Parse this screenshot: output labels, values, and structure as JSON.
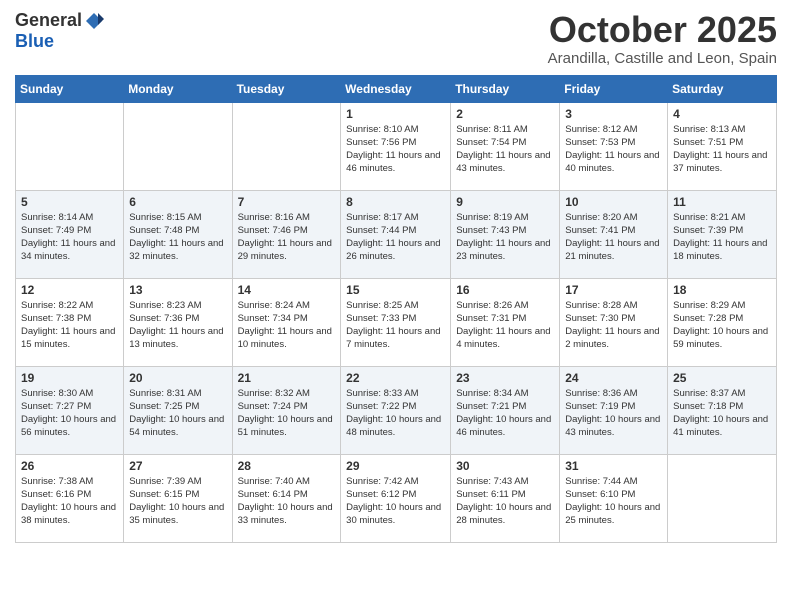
{
  "header": {
    "logo_general": "General",
    "logo_blue": "Blue",
    "month_title": "October 2025",
    "location": "Arandilla, Castille and Leon, Spain"
  },
  "days_of_week": [
    "Sunday",
    "Monday",
    "Tuesday",
    "Wednesday",
    "Thursday",
    "Friday",
    "Saturday"
  ],
  "weeks": [
    {
      "days": [
        {
          "num": "",
          "sunrise": "",
          "sunset": "",
          "daylight": ""
        },
        {
          "num": "",
          "sunrise": "",
          "sunset": "",
          "daylight": ""
        },
        {
          "num": "",
          "sunrise": "",
          "sunset": "",
          "daylight": ""
        },
        {
          "num": "1",
          "sunrise": "Sunrise: 8:10 AM",
          "sunset": "Sunset: 7:56 PM",
          "daylight": "Daylight: 11 hours and 46 minutes."
        },
        {
          "num": "2",
          "sunrise": "Sunrise: 8:11 AM",
          "sunset": "Sunset: 7:54 PM",
          "daylight": "Daylight: 11 hours and 43 minutes."
        },
        {
          "num": "3",
          "sunrise": "Sunrise: 8:12 AM",
          "sunset": "Sunset: 7:53 PM",
          "daylight": "Daylight: 11 hours and 40 minutes."
        },
        {
          "num": "4",
          "sunrise": "Sunrise: 8:13 AM",
          "sunset": "Sunset: 7:51 PM",
          "daylight": "Daylight: 11 hours and 37 minutes."
        }
      ]
    },
    {
      "days": [
        {
          "num": "5",
          "sunrise": "Sunrise: 8:14 AM",
          "sunset": "Sunset: 7:49 PM",
          "daylight": "Daylight: 11 hours and 34 minutes."
        },
        {
          "num": "6",
          "sunrise": "Sunrise: 8:15 AM",
          "sunset": "Sunset: 7:48 PM",
          "daylight": "Daylight: 11 hours and 32 minutes."
        },
        {
          "num": "7",
          "sunrise": "Sunrise: 8:16 AM",
          "sunset": "Sunset: 7:46 PM",
          "daylight": "Daylight: 11 hours and 29 minutes."
        },
        {
          "num": "8",
          "sunrise": "Sunrise: 8:17 AM",
          "sunset": "Sunset: 7:44 PM",
          "daylight": "Daylight: 11 hours and 26 minutes."
        },
        {
          "num": "9",
          "sunrise": "Sunrise: 8:19 AM",
          "sunset": "Sunset: 7:43 PM",
          "daylight": "Daylight: 11 hours and 23 minutes."
        },
        {
          "num": "10",
          "sunrise": "Sunrise: 8:20 AM",
          "sunset": "Sunset: 7:41 PM",
          "daylight": "Daylight: 11 hours and 21 minutes."
        },
        {
          "num": "11",
          "sunrise": "Sunrise: 8:21 AM",
          "sunset": "Sunset: 7:39 PM",
          "daylight": "Daylight: 11 hours and 18 minutes."
        }
      ]
    },
    {
      "days": [
        {
          "num": "12",
          "sunrise": "Sunrise: 8:22 AM",
          "sunset": "Sunset: 7:38 PM",
          "daylight": "Daylight: 11 hours and 15 minutes."
        },
        {
          "num": "13",
          "sunrise": "Sunrise: 8:23 AM",
          "sunset": "Sunset: 7:36 PM",
          "daylight": "Daylight: 11 hours and 13 minutes."
        },
        {
          "num": "14",
          "sunrise": "Sunrise: 8:24 AM",
          "sunset": "Sunset: 7:34 PM",
          "daylight": "Daylight: 11 hours and 10 minutes."
        },
        {
          "num": "15",
          "sunrise": "Sunrise: 8:25 AM",
          "sunset": "Sunset: 7:33 PM",
          "daylight": "Daylight: 11 hours and 7 minutes."
        },
        {
          "num": "16",
          "sunrise": "Sunrise: 8:26 AM",
          "sunset": "Sunset: 7:31 PM",
          "daylight": "Daylight: 11 hours and 4 minutes."
        },
        {
          "num": "17",
          "sunrise": "Sunrise: 8:28 AM",
          "sunset": "Sunset: 7:30 PM",
          "daylight": "Daylight: 11 hours and 2 minutes."
        },
        {
          "num": "18",
          "sunrise": "Sunrise: 8:29 AM",
          "sunset": "Sunset: 7:28 PM",
          "daylight": "Daylight: 10 hours and 59 minutes."
        }
      ]
    },
    {
      "days": [
        {
          "num": "19",
          "sunrise": "Sunrise: 8:30 AM",
          "sunset": "Sunset: 7:27 PM",
          "daylight": "Daylight: 10 hours and 56 minutes."
        },
        {
          "num": "20",
          "sunrise": "Sunrise: 8:31 AM",
          "sunset": "Sunset: 7:25 PM",
          "daylight": "Daylight: 10 hours and 54 minutes."
        },
        {
          "num": "21",
          "sunrise": "Sunrise: 8:32 AM",
          "sunset": "Sunset: 7:24 PM",
          "daylight": "Daylight: 10 hours and 51 minutes."
        },
        {
          "num": "22",
          "sunrise": "Sunrise: 8:33 AM",
          "sunset": "Sunset: 7:22 PM",
          "daylight": "Daylight: 10 hours and 48 minutes."
        },
        {
          "num": "23",
          "sunrise": "Sunrise: 8:34 AM",
          "sunset": "Sunset: 7:21 PM",
          "daylight": "Daylight: 10 hours and 46 minutes."
        },
        {
          "num": "24",
          "sunrise": "Sunrise: 8:36 AM",
          "sunset": "Sunset: 7:19 PM",
          "daylight": "Daylight: 10 hours and 43 minutes."
        },
        {
          "num": "25",
          "sunrise": "Sunrise: 8:37 AM",
          "sunset": "Sunset: 7:18 PM",
          "daylight": "Daylight: 10 hours and 41 minutes."
        }
      ]
    },
    {
      "days": [
        {
          "num": "26",
          "sunrise": "Sunrise: 7:38 AM",
          "sunset": "Sunset: 6:16 PM",
          "daylight": "Daylight: 10 hours and 38 minutes."
        },
        {
          "num": "27",
          "sunrise": "Sunrise: 7:39 AM",
          "sunset": "Sunset: 6:15 PM",
          "daylight": "Daylight: 10 hours and 35 minutes."
        },
        {
          "num": "28",
          "sunrise": "Sunrise: 7:40 AM",
          "sunset": "Sunset: 6:14 PM",
          "daylight": "Daylight: 10 hours and 33 minutes."
        },
        {
          "num": "29",
          "sunrise": "Sunrise: 7:42 AM",
          "sunset": "Sunset: 6:12 PM",
          "daylight": "Daylight: 10 hours and 30 minutes."
        },
        {
          "num": "30",
          "sunrise": "Sunrise: 7:43 AM",
          "sunset": "Sunset: 6:11 PM",
          "daylight": "Daylight: 10 hours and 28 minutes."
        },
        {
          "num": "31",
          "sunrise": "Sunrise: 7:44 AM",
          "sunset": "Sunset: 6:10 PM",
          "daylight": "Daylight: 10 hours and 25 minutes."
        },
        {
          "num": "",
          "sunrise": "",
          "sunset": "",
          "daylight": ""
        }
      ]
    }
  ]
}
